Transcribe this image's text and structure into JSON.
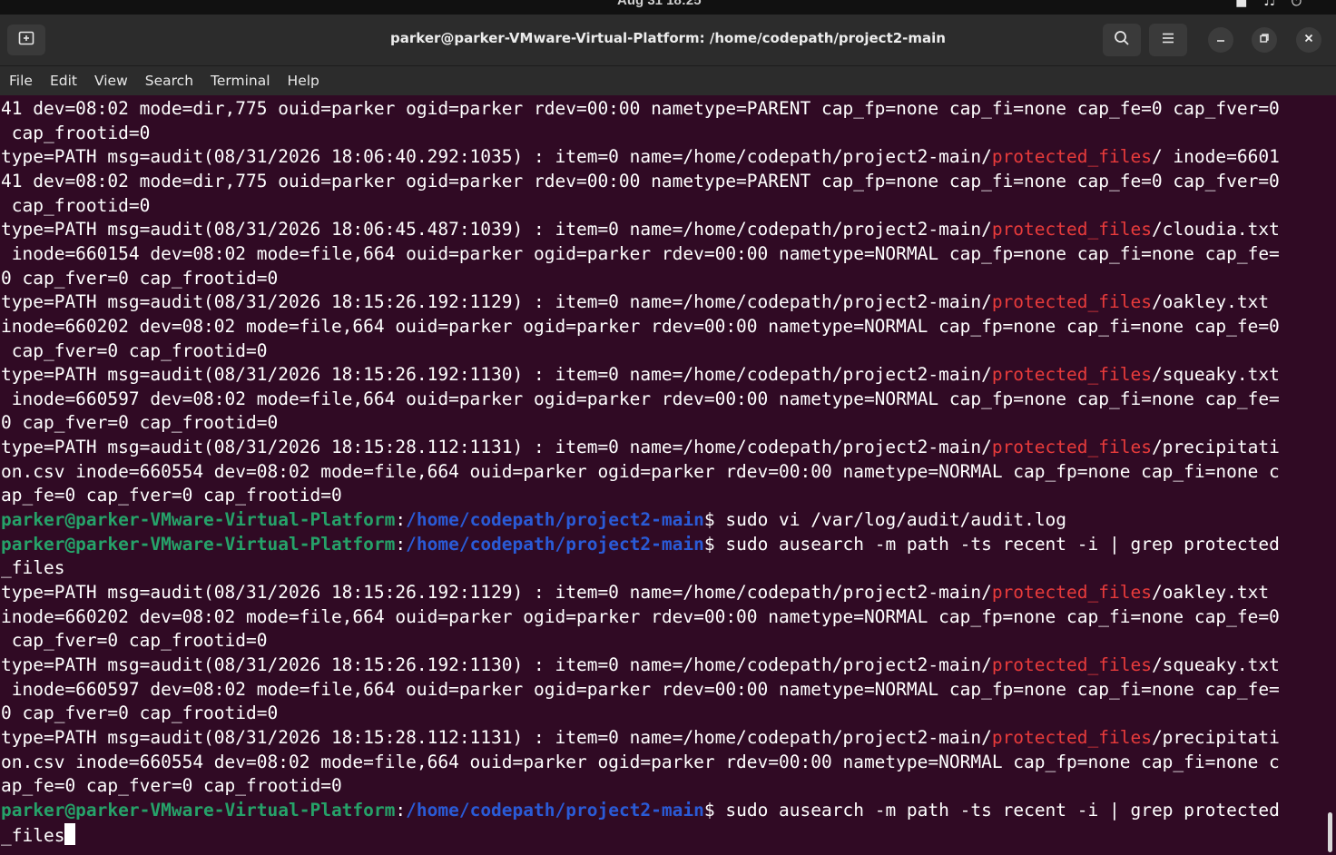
{
  "topbar": {
    "clock": "Aug 31  18:25"
  },
  "window": {
    "title": "parker@parker-VMware-Virtual-Platform: /home/codepath/project2-main"
  },
  "menu": [
    "File",
    "Edit",
    "View",
    "Search",
    "Terminal",
    "Help"
  ],
  "colors": {
    "background": "#300a24",
    "text": "#ffffff",
    "highlight_red": "#e83b3b",
    "prompt_green": "#26a269",
    "prompt_blue": "#2a5bd7"
  },
  "icons": {
    "new_tab": "new-tab-icon",
    "search": "search-icon",
    "menu": "hamburger-menu-icon",
    "minimize": "minimize-icon",
    "maximize": "restore-icon",
    "close": "close-icon"
  },
  "terminal": {
    "lines": [
      [
        {
          "t": "41 dev=08:02 mode=dir,775 ouid=parker ogid=parker rdev=00:00 nametype=PARENT cap_fp=none cap_fi=none cap_fe=0 cap_fver=0"
        }
      ],
      [
        {
          "t": " cap_frootid=0"
        }
      ],
      [
        {
          "t": "type=PATH msg=audit(08/31/2026 18:06:40.292:1035) : item=0 name=/home/codepath/project2-main/"
        },
        {
          "t": "protected_files",
          "c": "red"
        },
        {
          "t": "/ inode=6601"
        }
      ],
      [
        {
          "t": "41 dev=08:02 mode=dir,775 ouid=parker ogid=parker rdev=00:00 nametype=PARENT cap_fp=none cap_fi=none cap_fe=0 cap_fver=0"
        }
      ],
      [
        {
          "t": " cap_frootid=0"
        }
      ],
      [
        {
          "t": "type=PATH msg=audit(08/31/2026 18:06:45.487:1039) : item=0 name=/home/codepath/project2-main/"
        },
        {
          "t": "protected_files",
          "c": "red"
        },
        {
          "t": "/cloudia.txt"
        }
      ],
      [
        {
          "t": " inode=660154 dev=08:02 mode=file,664 ouid=parker ogid=parker rdev=00:00 nametype=NORMAL cap_fp=none cap_fi=none cap_fe="
        }
      ],
      [
        {
          "t": "0 cap_fver=0 cap_frootid=0"
        }
      ],
      [
        {
          "t": "type=PATH msg=audit(08/31/2026 18:15:26.192:1129) : item=0 name=/home/codepath/project2-main/"
        },
        {
          "t": "protected_files",
          "c": "red"
        },
        {
          "t": "/oakley.txt"
        }
      ],
      [
        {
          "t": "inode=660202 dev=08:02 mode=file,664 ouid=parker ogid=parker rdev=00:00 nametype=NORMAL cap_fp=none cap_fi=none cap_fe=0"
        }
      ],
      [
        {
          "t": " cap_fver=0 cap_frootid=0"
        }
      ],
      [
        {
          "t": "type=PATH msg=audit(08/31/2026 18:15:26.192:1130) : item=0 name=/home/codepath/project2-main/"
        },
        {
          "t": "protected_files",
          "c": "red"
        },
        {
          "t": "/squeaky.txt"
        }
      ],
      [
        {
          "t": " inode=660597 dev=08:02 mode=file,664 ouid=parker ogid=parker rdev=00:00 nametype=NORMAL cap_fp=none cap_fi=none cap_fe="
        }
      ],
      [
        {
          "t": "0 cap_fver=0 cap_frootid=0"
        }
      ],
      [
        {
          "t": "type=PATH msg=audit(08/31/2026 18:15:28.112:1131) : item=0 name=/home/codepath/project2-main/"
        },
        {
          "t": "protected_files",
          "c": "red"
        },
        {
          "t": "/precipitati"
        }
      ],
      [
        {
          "t": "on.csv inode=660554 dev=08:02 mode=file,664 ouid=parker ogid=parker rdev=00:00 nametype=NORMAL cap_fp=none cap_fi=none c"
        }
      ],
      [
        {
          "t": "ap_fe=0 cap_fver=0 cap_frootid=0"
        }
      ],
      [
        {
          "t": "parker@parker-VMware-Virtual-Platform",
          "c": "green"
        },
        {
          "t": ":"
        },
        {
          "t": "/home/codepath/project2-main",
          "c": "blue"
        },
        {
          "t": "$ sudo vi /var/log/audit/audit.log"
        }
      ],
      [
        {
          "t": "parker@parker-VMware-Virtual-Platform",
          "c": "green"
        },
        {
          "t": ":"
        },
        {
          "t": "/home/codepath/project2-main",
          "c": "blue"
        },
        {
          "t": "$ sudo ausearch -m path -ts recent -i | grep protected"
        }
      ],
      [
        {
          "t": "_files"
        }
      ],
      [
        {
          "t": "type=PATH msg=audit(08/31/2026 18:15:26.192:1129) : item=0 name=/home/codepath/project2-main/"
        },
        {
          "t": "protected_files",
          "c": "red"
        },
        {
          "t": "/oakley.txt"
        }
      ],
      [
        {
          "t": "inode=660202 dev=08:02 mode=file,664 ouid=parker ogid=parker rdev=00:00 nametype=NORMAL cap_fp=none cap_fi=none cap_fe=0"
        }
      ],
      [
        {
          "t": " cap_fver=0 cap_frootid=0"
        }
      ],
      [
        {
          "t": "type=PATH msg=audit(08/31/2026 18:15:26.192:1130) : item=0 name=/home/codepath/project2-main/"
        },
        {
          "t": "protected_files",
          "c": "red"
        },
        {
          "t": "/squeaky.txt"
        }
      ],
      [
        {
          "t": " inode=660597 dev=08:02 mode=file,664 ouid=parker ogid=parker rdev=00:00 nametype=NORMAL cap_fp=none cap_fi=none cap_fe="
        }
      ],
      [
        {
          "t": "0 cap_fver=0 cap_frootid=0"
        }
      ],
      [
        {
          "t": "type=PATH msg=audit(08/31/2026 18:15:28.112:1131) : item=0 name=/home/codepath/project2-main/"
        },
        {
          "t": "protected_files",
          "c": "red"
        },
        {
          "t": "/precipitati"
        }
      ],
      [
        {
          "t": "on.csv inode=660554 dev=08:02 mode=file,664 ouid=parker ogid=parker rdev=00:00 nametype=NORMAL cap_fp=none cap_fi=none c"
        }
      ],
      [
        {
          "t": "ap_fe=0 cap_fver=0 cap_frootid=0"
        }
      ],
      [
        {
          "t": "parker@parker-VMware-Virtual-Platform",
          "c": "green"
        },
        {
          "t": ":"
        },
        {
          "t": "/home/codepath/project2-main",
          "c": "blue"
        },
        {
          "t": "$ sudo ausearch -m path -ts recent -i | grep protected"
        }
      ],
      [
        {
          "t": "_files"
        },
        {
          "cursor": true
        }
      ]
    ]
  }
}
